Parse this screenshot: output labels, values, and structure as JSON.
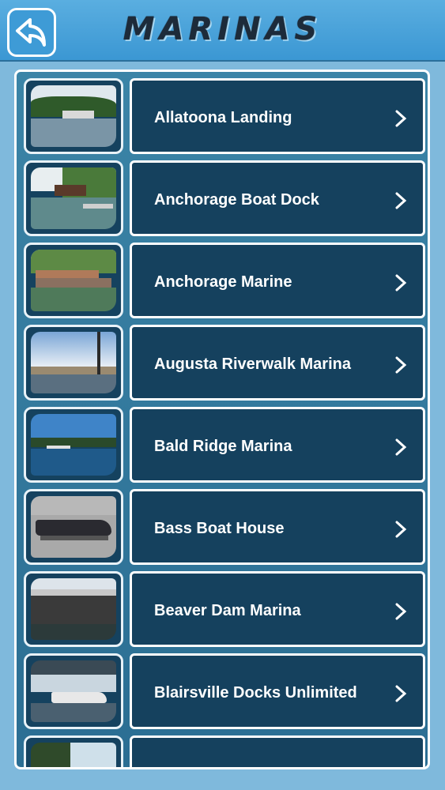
{
  "header": {
    "title": "MARINAS",
    "back_icon": "back-arrow-icon"
  },
  "list": {
    "items": [
      {
        "label": "Allatoona Landing",
        "thumb": "lake-shore",
        "chevron": "chevron-right-icon"
      },
      {
        "label": "Anchorage Boat Dock",
        "thumb": "dock-trees",
        "chevron": "chevron-right-icon"
      },
      {
        "label": "Anchorage Marine",
        "thumb": "boathouse",
        "chevron": "chevron-right-icon"
      },
      {
        "label": "Augusta Riverwalk Marina",
        "thumb": "cloudy-dock",
        "chevron": "chevron-right-icon"
      },
      {
        "label": "Bald Ridge Marina",
        "thumb": "blue-lake",
        "chevron": "chevron-right-icon"
      },
      {
        "label": "Bass Boat House",
        "thumb": "boat-trailer",
        "chevron": "chevron-right-icon"
      },
      {
        "label": "Beaver Dam Marina",
        "thumb": "covered-slips",
        "chevron": "chevron-right-icon"
      },
      {
        "label": "Blairsville Docks Unlimited",
        "thumb": "boat-lift",
        "chevron": "chevron-right-icon"
      },
      {
        "label": "",
        "thumb": "partial-shore",
        "chevron": "chevron-right-icon"
      }
    ]
  },
  "colors": {
    "header": "#4aa6dc",
    "panel": "#2f79a0",
    "button": "#15415e",
    "text": "#ffffff"
  }
}
